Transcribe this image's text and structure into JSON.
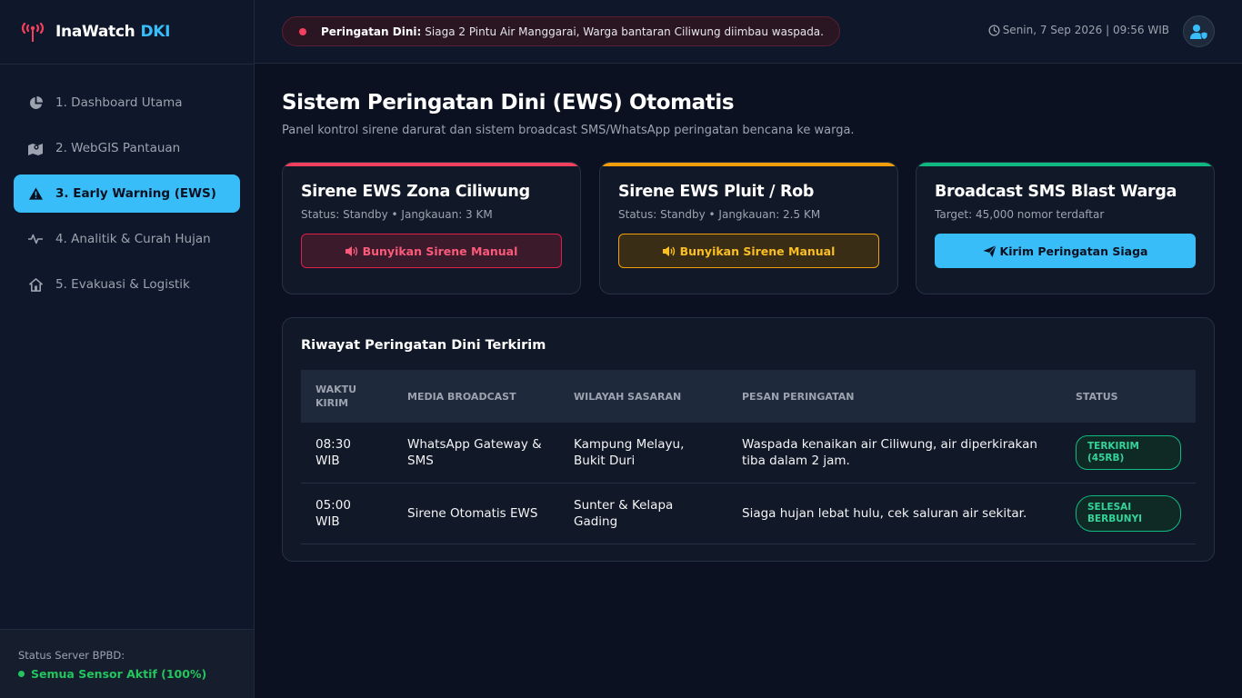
{
  "brand": {
    "name": "InaWatch",
    "accent": "DKI"
  },
  "sidebar": {
    "items": [
      {
        "label": "1. Dashboard Utama",
        "icon": "pie-chart-icon"
      },
      {
        "label": "2. WebGIS Pantauan",
        "icon": "map-icon"
      },
      {
        "label": "3. Early Warning (EWS)",
        "icon": "warning-icon",
        "active": true
      },
      {
        "label": "4. Analitik & Curah Hujan",
        "icon": "pulse-icon"
      },
      {
        "label": "5. Evakuasi & Logistik",
        "icon": "shelter-icon"
      }
    ],
    "server_label": "Status Server BPBD:",
    "server_value": "Semua Sensor Aktif (100%)"
  },
  "header": {
    "alert_strong": "Peringatan Dini:",
    "alert_text": "Siaga 2 Pintu Air Manggarai, Warga bantaran Ciliwung diimbau waspada.",
    "datetime": "Senin, 7 Sep 2026 | 09:56 WIB"
  },
  "main": {
    "title": "Sistem Peringatan Dini (EWS) Otomatis",
    "subtitle": "Panel kontrol sirene darurat dan sistem broadcast SMS/WhatsApp peringatan bencana ke warga."
  },
  "cards": [
    {
      "title": "Sirene EWS Zona Ciliwung",
      "meta": "Status: Standby • Jangkauan: 3 KM",
      "button": "Bunyikan Sirene Manual",
      "accent": "#f43f5e"
    },
    {
      "title": "Sirene EWS Pluit / Rob",
      "meta": "Status: Standby • Jangkauan: 2.5 KM",
      "button": "Bunyikan Sirene Manual",
      "accent": "#f59e0b"
    },
    {
      "title": "Broadcast SMS Blast Warga",
      "meta": "Target: 45,000 nomor terdaftar",
      "button": "Kirim Peringatan Siaga",
      "accent": "#10b981"
    }
  ],
  "history": {
    "title": "Riwayat Peringatan Dini Terkirim",
    "columns": [
      "WAKTU KIRIM",
      "MEDIA BROADCAST",
      "WILAYAH SASARAN",
      "PESAN PERINGATAN",
      "STATUS"
    ],
    "rows": [
      {
        "time": "08:30 WIB",
        "media": "WhatsApp Gateway & SMS",
        "area": "Kampung Melayu, Bukit Duri",
        "message": "Waspada kenaikan air Ciliwung, air diperkirakan tiba dalam 2 jam.",
        "status": "TERKIRIM (45RB)"
      },
      {
        "time": "05:00 WIB",
        "media": "Sirene Otomatis EWS",
        "area": "Sunter & Kelapa Gading",
        "message": "Siaga hujan lebat hulu, cek saluran air sekitar.",
        "status": "SELESAI BERBUNYI"
      }
    ]
  },
  "colors": {
    "brand_accent": "#38bdf8",
    "alert": "#f43f5e",
    "success": "#22c55e",
    "amber": "#f59e0b"
  }
}
